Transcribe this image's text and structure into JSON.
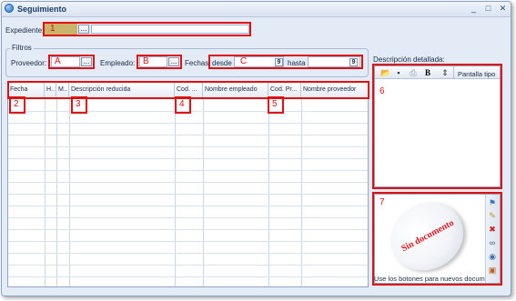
{
  "window": {
    "title": "Seguimiento"
  },
  "expediente": {
    "label": "Expediente:",
    "marker": "1",
    "browse": "..."
  },
  "filtros": {
    "legend": "Filtros",
    "proveedor": {
      "label": "Proveedor:",
      "marker": "A",
      "browse": "..."
    },
    "empleado": {
      "label": "Empleado:",
      "marker": "B",
      "browse": "..."
    },
    "fechas": {
      "label": "Fechas:",
      "desde": "desde",
      "hasta": "hasta",
      "marker": "C",
      "cal_glyph": "9"
    }
  },
  "grid": {
    "columns": [
      "Fecha",
      "H..",
      "M..",
      "Descripción reducida",
      "Cod. ...",
      "Nombre empleado",
      "Cod. Pr...",
      "Nombre proveedor"
    ],
    "markers": [
      "2",
      "3",
      "4",
      "5"
    ]
  },
  "descripcion": {
    "label": "Descripción detallada:",
    "pantalla": "Pantalla tipo",
    "marker": "6",
    "toolbar_icons": [
      "open-folder-icon",
      "save-icon",
      "print-icon",
      "bold-icon",
      "scroll-icon"
    ]
  },
  "documento": {
    "marker": "7",
    "stamp": "Sin documento",
    "hint": "Use los botones para nuevos documen",
    "side_icons": [
      "scan-icon",
      "new-document-icon",
      "delete-document-icon",
      "link-icon",
      "view-icon",
      "export-icon"
    ]
  },
  "colors": {
    "accent_red": "#e01010",
    "expediente_fill": "#c8b56a",
    "stamp_red": "#e0131b"
  }
}
